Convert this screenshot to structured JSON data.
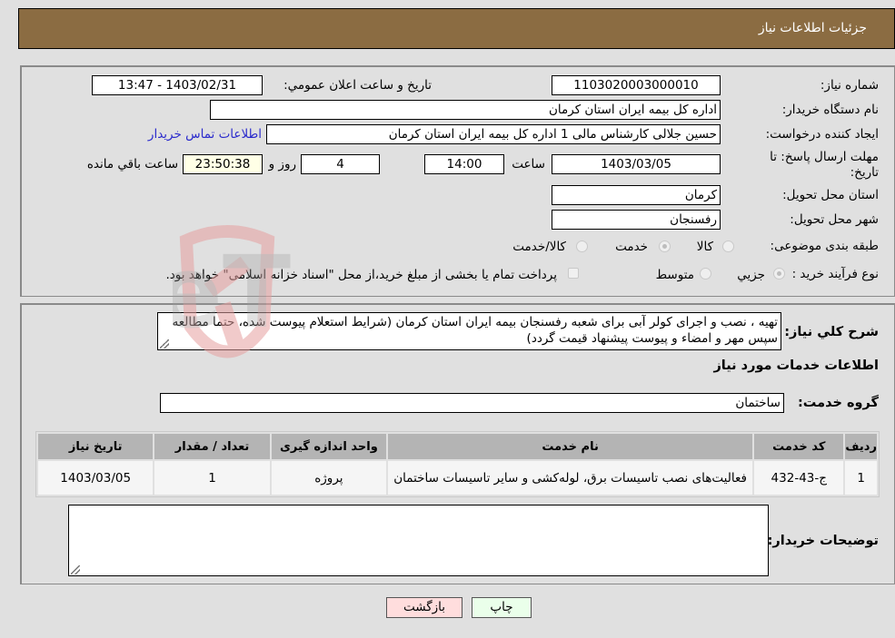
{
  "header": {
    "title": "جزئیات اطلاعات نیاز"
  },
  "form": {
    "need_number": {
      "label": "شماره نیاز:",
      "value": "1103020003000010"
    },
    "announce_datetime": {
      "label": "تاریخ و ساعت اعلان عمومي:",
      "value": "1403/02/31 - 13:47"
    },
    "buyer_org": {
      "label": "نام دستگاه خریدار:",
      "value": "اداره کل بیمه ایران استان کرمان"
    },
    "requester": {
      "label": "ایجاد کننده درخواست:",
      "value": "حسین جلالی کارشناس مالی 1 اداره کل بیمه ایران استان کرمان",
      "contact_link": "اطلاعات تماس خریدار"
    },
    "deadline": {
      "label_line1": "مهلت ارسال پاسخ: تا",
      "label_line2": "تاریخ:",
      "date": "1403/03/05",
      "time_label": "ساعت",
      "time": "14:00",
      "days": "4",
      "days_label": "روز و",
      "remaining": "23:50:38",
      "remaining_label": "ساعت باقي مانده"
    },
    "province": {
      "label": "استان محل تحویل:",
      "value": "کرمان"
    },
    "city": {
      "label": "شهر محل تحویل:",
      "value": "رفسنجان"
    },
    "category": {
      "label": "طبقه بندی موضوعی:",
      "options": [
        {
          "label": "کالا",
          "checked": false
        },
        {
          "label": "خدمت",
          "checked": true
        },
        {
          "label": "کالا/خدمت",
          "checked": false
        }
      ]
    },
    "purchase_type": {
      "label": "نوع فرآیند خرید :",
      "options": [
        {
          "label": "جزيي",
          "checked": true
        },
        {
          "label": "متوسط",
          "checked": false
        }
      ],
      "treasury_checkbox_label": "پرداخت تمام یا بخشی از مبلغ خرید،از محل \"اسناد خزانه اسلامی\" خواهد بود.",
      "treasury_checked": false
    }
  },
  "description": {
    "label": "شرح کلي نياز:",
    "value": "تهیه ، نصب و اجرای کولر آبی برای شعبه رفسنجان بیمه ایران استان کرمان (شرایط استعلام  پیوست شده، حتما مطالعه سپس مهر و امضاء و پیوست پیشنهاد قیمت گردد)"
  },
  "services": {
    "section_title": "اطلاعات خدمات مورد نياز",
    "group_label": "گروه خدمت:",
    "group_value": "ساختمان",
    "table": {
      "headers": [
        "ردیف",
        "کد خدمت",
        "نام خدمت",
        "واحد اندازه گیری",
        "تعداد / مقدار",
        "تاریخ نیاز"
      ],
      "rows": [
        [
          "1",
          "ج-43-432",
          "فعالیت‌های نصب تاسیسات برق، لوله‌کشی و سایر تاسیسات ساختمان",
          "پروژه",
          "1",
          "1403/03/05"
        ]
      ]
    }
  },
  "buyer_notes": {
    "label": "توضیحات خریدار:",
    "value": ""
  },
  "buttons": {
    "print": "چاپ",
    "back": "بازگشت"
  },
  "watermark": {
    "text": "AriaTender.neT"
  },
  "colors": {
    "header_bg": "#8b6c42",
    "page_bg": "#e0e0e0",
    "link": "#2b2bcc",
    "print_btn": "#eaffea",
    "back_btn": "#ffdddd"
  }
}
